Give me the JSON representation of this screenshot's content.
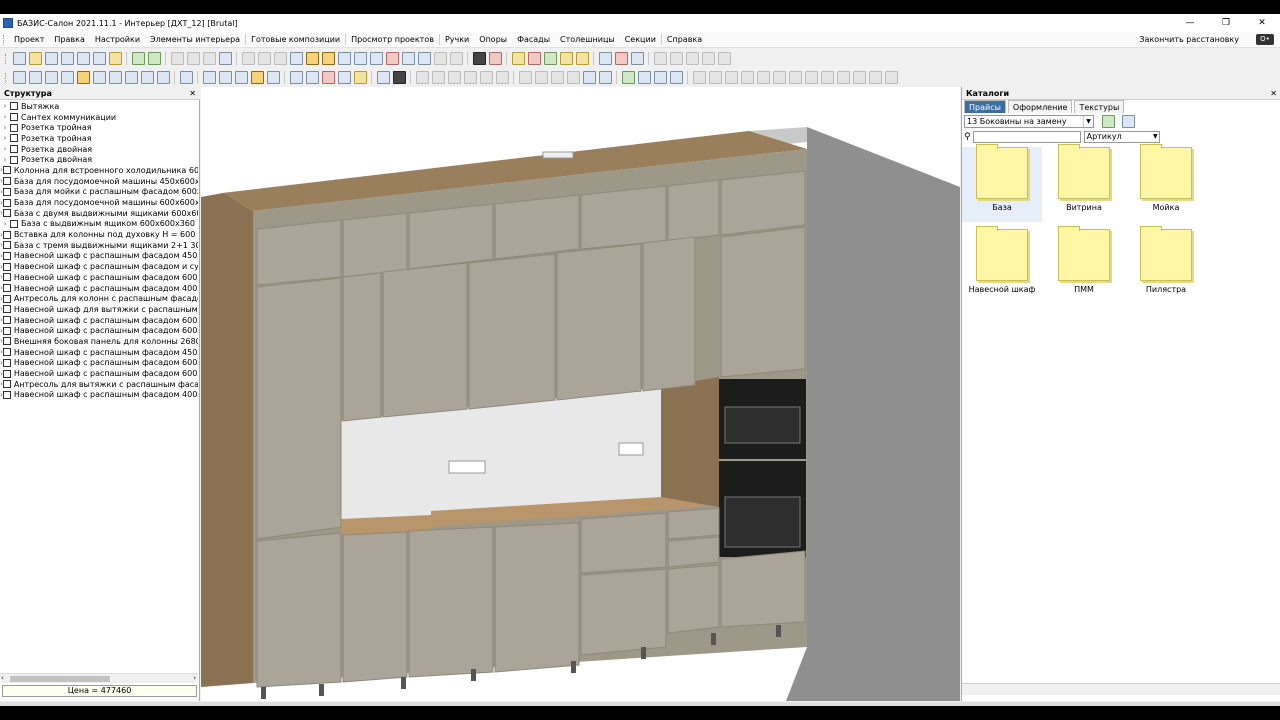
{
  "window": {
    "title": "БАЗИС-Салон 2021.11.1 - Интерьер [ДХТ_12] [Brutal]",
    "controls": [
      "—",
      "❐",
      "✕"
    ]
  },
  "menu": {
    "items": [
      "Проект",
      "Правка",
      "Настройки",
      "Элементы интерьера",
      "Готовые композиции",
      "Просмотр проектов",
      "Ручки",
      "Опоры",
      "Фасады",
      "Столешницы",
      "Секции",
      "Справка"
    ],
    "finish_label": "Закончить расстановку",
    "key_label": "O•"
  },
  "structure": {
    "title": "Структура",
    "items": [
      "Вытяжка",
      "Сантех коммуникации",
      "Розетка тройная",
      "Розетка тройная",
      "Розетка двойная",
      "Розетка двойная",
      "Колонна для встроенного холодильника 60",
      "База для посудомоечной машины 450х600х",
      "База для мойки с распашным фасадом 600х",
      "База для посудомоечной машины 600х600х",
      "База с двумя выдвижными ящиками 600х600",
      "База с выдвижным ящиком 600х600х360",
      "Вставка для колонны под духовку Н = 600 и",
      "База с тремя выдвижными ящиками 2+1 300",
      "Навесной шкаф с распашным фасадом 450х",
      "Навесной шкаф с распашным фасадом и суш",
      "Навесной шкаф с распашным фасадом 600х",
      "Навесной шкаф с распашным фасадом 400х",
      "Антресоль для колонн с распашным фасадо",
      "Навесной шкаф для вытяжки с распашным ф",
      "Навесной шкаф с распашным фасадом 600х",
      "Навесной шкаф с распашным фасадом 600х",
      "Внешняя боковая панель для колонны 2680",
      "Навесной шкаф с распашным фасадом 450х",
      "Навесной шкаф с распашным фасадом 600х",
      "Навесной шкаф с распашным фасадом 600х",
      "Антресоль для вытяжки с распашным фасад",
      "Навесной шкаф с распашным фасадом 400х"
    ],
    "price": "Цена = 477460"
  },
  "catalogs": {
    "title": "Каталоги",
    "tabs": [
      "Прайсы",
      "Оформление",
      "Текстуры"
    ],
    "selected_catalog": "13 Боковины на замену",
    "search_value": "",
    "search_field": "Артикул",
    "folders": [
      "База",
      "Витрина",
      "Мойка",
      "Навесной шкаф",
      "ПММ",
      "Пилястра"
    ]
  },
  "colors": {
    "facade": "#aaa598",
    "carcass": "#8a7152",
    "worktop": "#b8956a",
    "wall_right": "#8f8f8f",
    "tab_active": "#3b6ea5",
    "folder": "#fff7a6"
  }
}
